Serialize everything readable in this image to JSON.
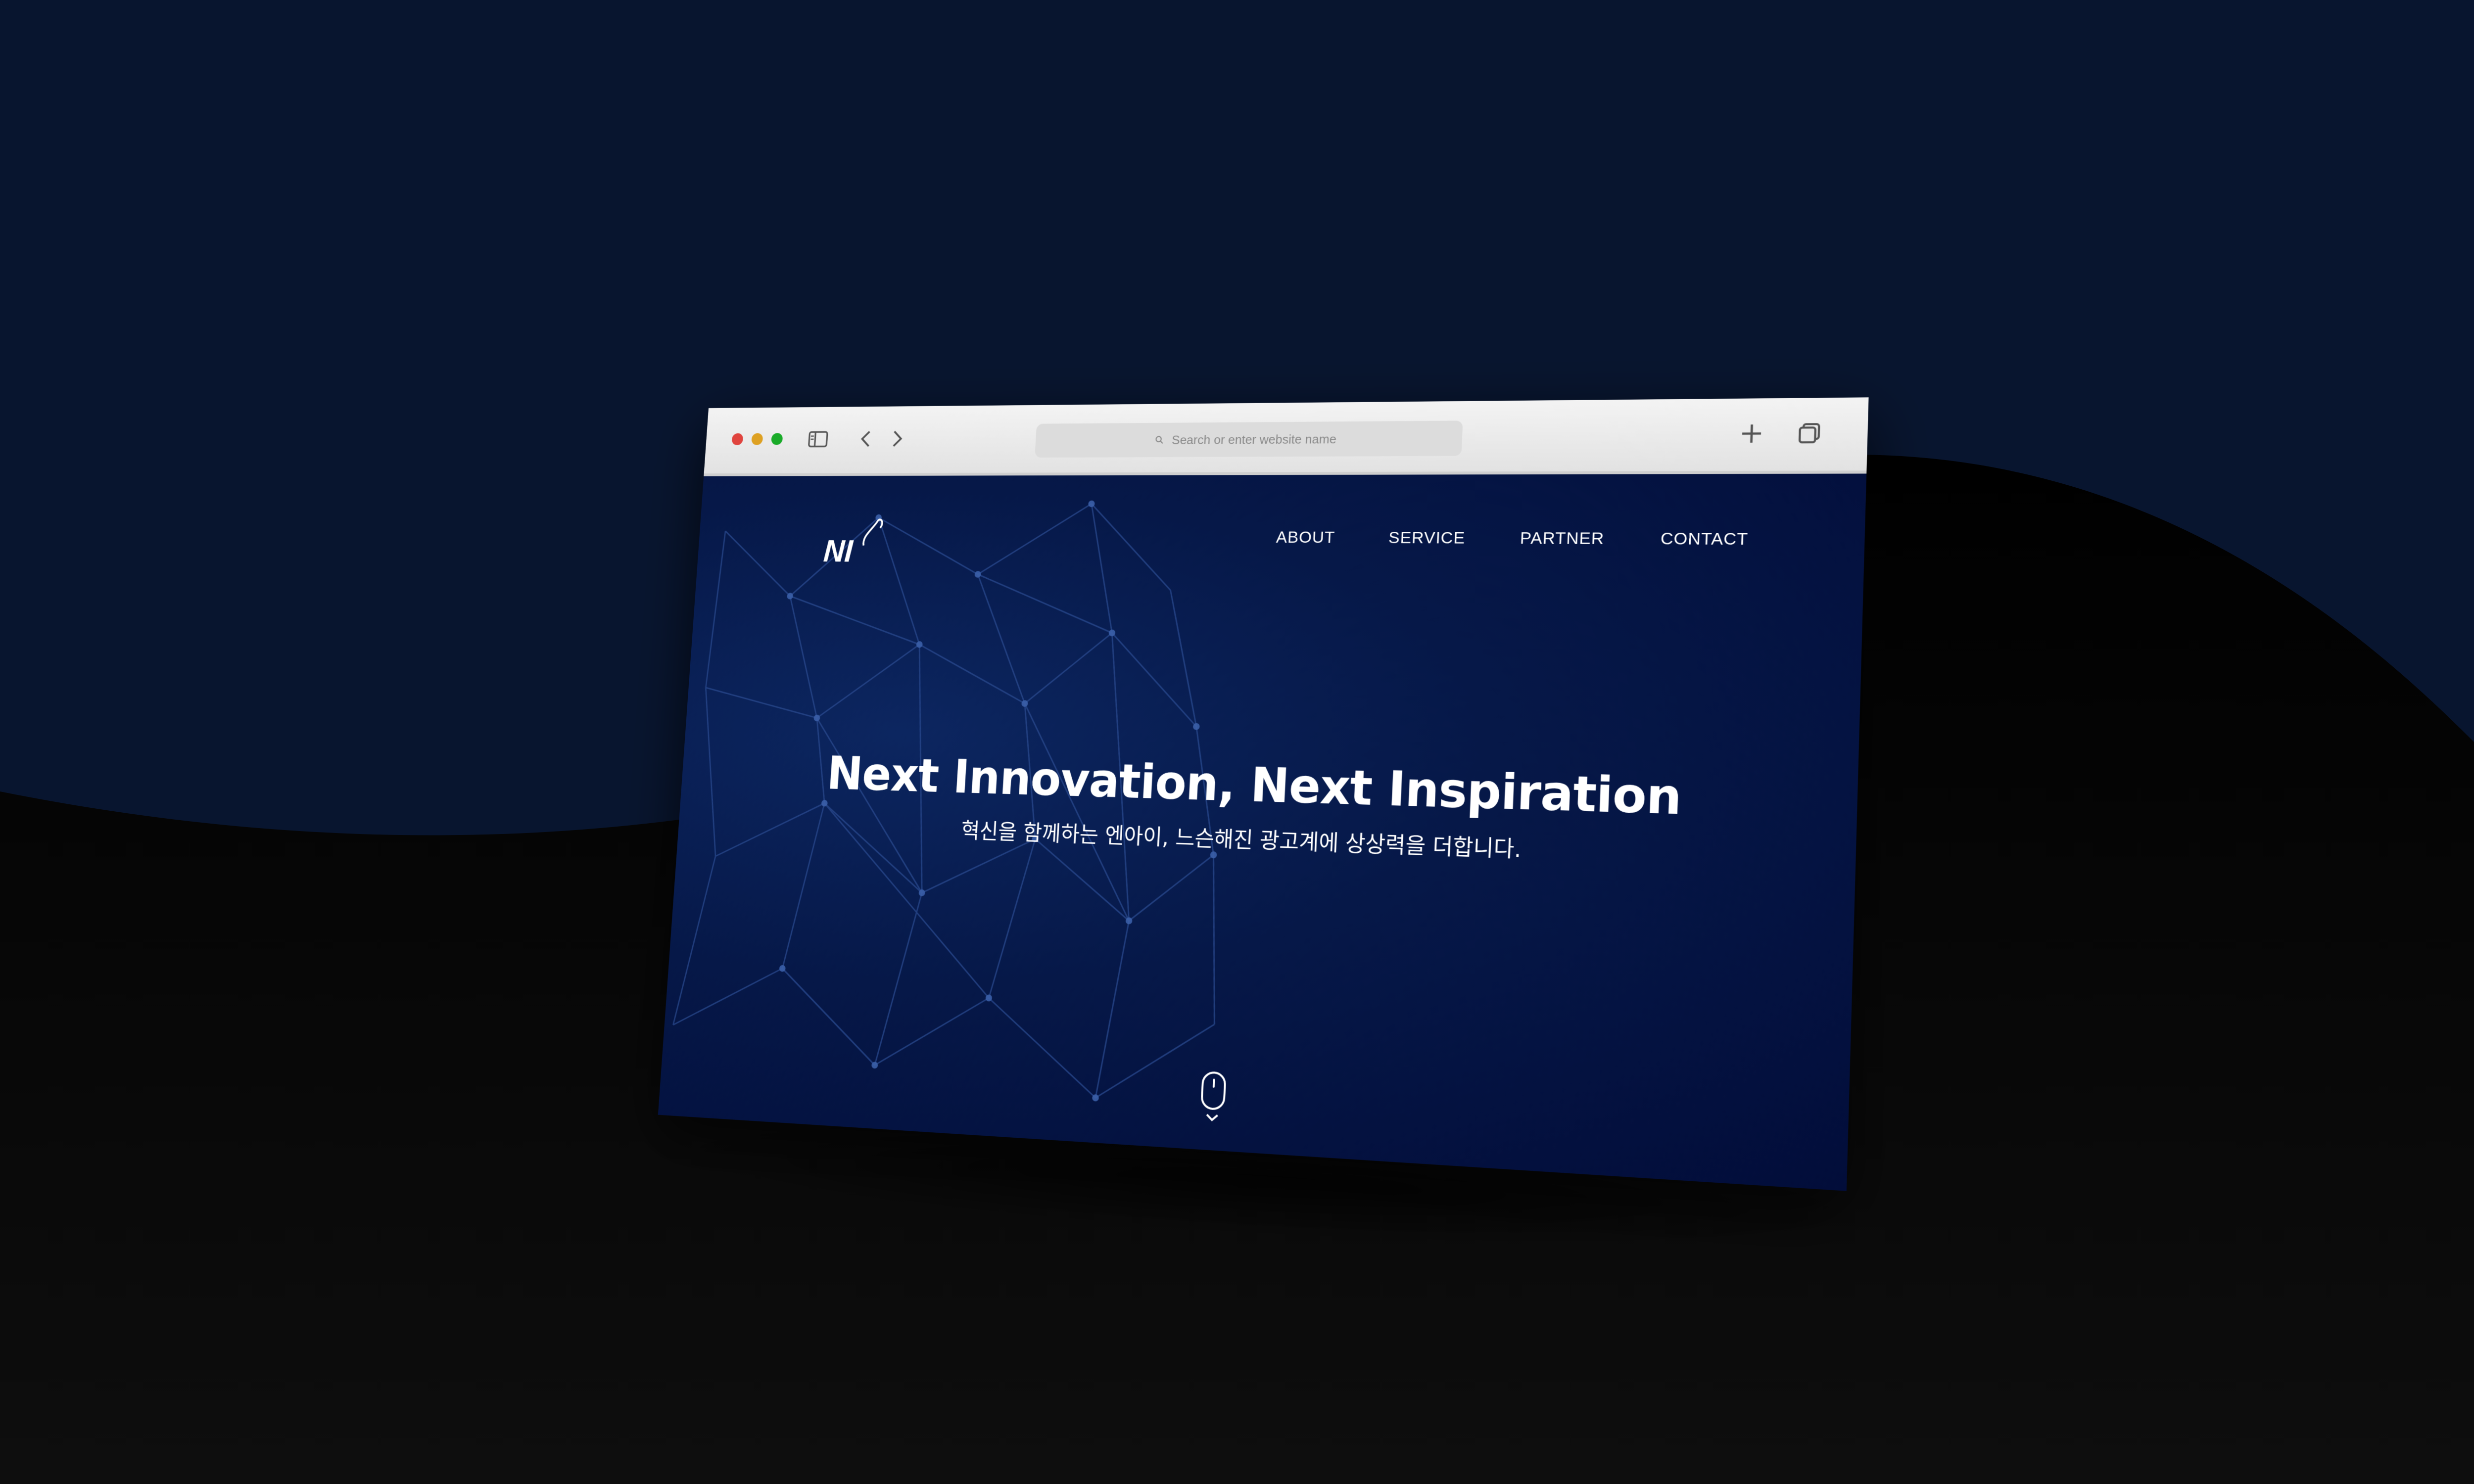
{
  "browser": {
    "address_placeholder": "Search or enter website name",
    "icons": [
      "close-light",
      "minimize-light",
      "zoom-light",
      "sidebar-icon",
      "back-icon",
      "forward-icon",
      "search-icon",
      "plus-icon",
      "tabs-icon"
    ]
  },
  "site": {
    "logo_text": "NI",
    "nav": {
      "about": "ABOUT",
      "service": "SERVICE",
      "partner": "PARTNER",
      "contact": "CONTACT"
    },
    "hero": {
      "title": "Next Innovation, Next Inspiration",
      "subtitle": "혁신을 함께하는 엔아이, 느슨해진 광고계에 상상력을 더합니다."
    },
    "scroll_indicator_icon": "mouse-scroll-icon"
  },
  "colors": {
    "page_background": "#08152f",
    "dark_wave": "#050505",
    "site_background": "#061848",
    "network_lines": "#2a4a8f",
    "text": "#ffffff",
    "toolbar": "#ececec"
  }
}
